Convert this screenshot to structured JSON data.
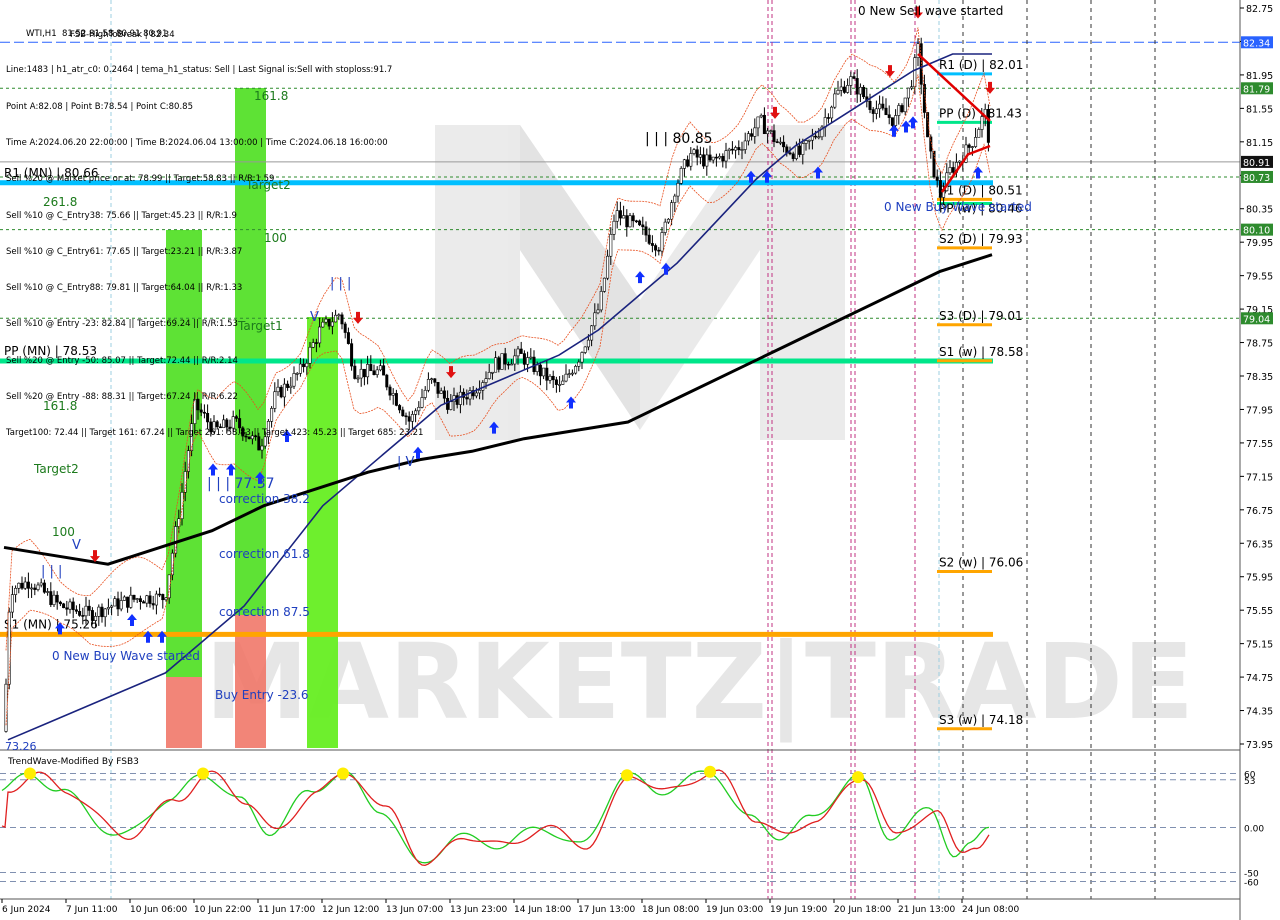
{
  "chart_data": {
    "type": "candlestick",
    "symbol_line": "WTI,H1  81.52 81.58 80.91 80.91",
    "info_lines": [
      "Line:1483 | h1_atr_c0: 0.2464 | tema_h1_status: Sell | Last Signal is:Sell with stoploss:91.7",
      "Point A:82.08 | Point B:78.54 | Point C:80.85",
      "Time A:2024.06.20 22:00:00 | Time B:2024.06.04 13:00:00 | Time C:2024.06.18 16:00:00",
      "Sell %20 @ Market price or at: 78.99 || Target:58.83 || R/R:1.59",
      "Sell %10 @ C_Entry38: 75.66 || Target:45.23 || R/R:1.9",
      "Sell %10 @ C_Entry61: 77.65 || Target:23.21 || R/R:3.87",
      "Sell %10 @ C_Entry88: 79.81 || Target:64.04 || R/R:1.33",
      "Sell %10 @ Entry -23: 82.84 || Target:69.24 || R/R:1.53",
      "Sell %20 @ Entry -50: 85.07 || Target:72.44 || R/R:2.14",
      "Sell %20 @ Entry -88: 88.31 || Target:67.24 || R/R:6.22",
      "Target100: 72.44 || Target 161: 67.24 || Target 261: 58.83 || Target 423: 45.23 || Target 685: 23.21"
    ],
    "fsb_overlay": "FSB-HighToBreak | 82.34",
    "y_axis": {
      "min": 73.95,
      "max": 82.75,
      "ticks": [
        "82.75",
        "82.35",
        "81.95",
        "81.55",
        "81.15",
        "80.75",
        "80.35",
        "79.95",
        "79.55",
        "79.15",
        "78.75",
        "78.35",
        "77.95",
        "77.55",
        "77.15",
        "76.75",
        "76.35",
        "75.95",
        "75.55",
        "75.15",
        "74.75",
        "74.35",
        "73.95"
      ]
    },
    "x_ticks": [
      "6 Jun 2024",
      "7 Jun 11:00",
      "10 Jun 06:00",
      "10 Jun 22:00",
      "11 Jun 17:00",
      "12 Jun 12:00",
      "13 Jun 07:00",
      "13 Jun 23:00",
      "14 Jun 18:00",
      "17 Jun 13:00",
      "18 Jun 08:00",
      "19 Jun 03:00",
      "19 Jun 19:00",
      "20 Jun 18:00",
      "21 Jun 13:00",
      "24 Jun 08:00"
    ],
    "price_badges": [
      {
        "value": "82.34",
        "color": "#2962ff"
      },
      {
        "value": "81.79",
        "color": "#2e8b2e"
      },
      {
        "value": "80.91",
        "color": "#111111"
      },
      {
        "value": "80.73",
        "color": "#2e8b2e"
      },
      {
        "value": "80.10",
        "color": "#2e8b2e"
      },
      {
        "value": "79.04",
        "color": "#2e8b2e"
      }
    ],
    "levels": [
      {
        "label": "R1 (MN) | 80.66",
        "value": 80.66,
        "color": "#00bfff"
      },
      {
        "label": "PP (MN) | 78.53",
        "value": 78.53,
        "color": "#00e68a"
      },
      {
        "label": "S1 (MN) | 75.26",
        "value": 75.26,
        "color": "#ffa500"
      },
      {
        "label": "R1 (D) | 82.01",
        "value": 82.01,
        "color": "#00bfff"
      },
      {
        "label": "PP (D) | 81.43",
        "value": 81.43,
        "color": "#00e68a"
      },
      {
        "label": "S1 (D) | 80.51",
        "value": 80.51,
        "color": "#ffa500"
      },
      {
        "label": "PP (w) | 80.46",
        "value": 80.46,
        "color": "#00e68a"
      },
      {
        "label": "S2 (D) | 79.93",
        "value": 79.93,
        "color": "#ffa500"
      },
      {
        "label": "S3 (D) | 79.01",
        "value": 79.01,
        "color": "#ffa500"
      },
      {
        "label": "S1 (w) | 78.58",
        "value": 78.58,
        "color": "#ffa500"
      },
      {
        "label": "S2 (w) | 76.06",
        "value": 76.06,
        "color": "#ffa500"
      },
      {
        "label": "S3 (w) | 74.18",
        "value": 74.18,
        "color": "#ffa500"
      }
    ],
    "annotations": {
      "sell_wave": "0 New Sell wave started",
      "buy_wave_1": "0 New Buy Wave started",
      "buy_wave_2": "0 New Buy Wave started",
      "target2_top": "Target2",
      "target1": "Target1",
      "target2_left": "Target2",
      "fib_261": "261.8",
      "fib_100_top": "100",
      "fib_161_top": "161.8",
      "fib_161_left": "161.8",
      "fib_100_left": "100",
      "correction_38": "correction 38.2",
      "correction_61": "correction 61.8",
      "correction_87": "correction 87.5",
      "buy_entry": "Buy Entry -23.6",
      "wave_77": "| | | 77.37",
      "wave_80": "| | | 80.85",
      "wave_iii": "| | |",
      "wave_iii_left": "| | |",
      "wave_iv": "| V",
      "wave_v": "V",
      "wave_v2": "V",
      "bottom_val": "73.26"
    },
    "ema_short_path_values": [
      74.0,
      74.2,
      74.4,
      74.6,
      74.8,
      75.2,
      75.6,
      76.2,
      76.8,
      77.2,
      77.6,
      78.0,
      78.2,
      78.4,
      78.6,
      78.9,
      79.3,
      79.7,
      80.2,
      80.7,
      81.1,
      81.4,
      81.7,
      82.0,
      82.2,
      82.2
    ],
    "ema_long_path_values": [
      76.3,
      76.2,
      76.1,
      76.3,
      76.5,
      76.8,
      77.0,
      77.2,
      77.35,
      77.45,
      77.6,
      77.7,
      77.8,
      78.1,
      78.4,
      78.7,
      79.0,
      79.3,
      79.6,
      79.8
    ],
    "indicator": {
      "title": "TrendWave-Modified By FSB3",
      "levels": [
        "60",
        "53",
        "0.00",
        "-50",
        "-60"
      ],
      "ymin": -75,
      "ymax": 75
    }
  },
  "watermark": "MARKETZ|TRADE"
}
